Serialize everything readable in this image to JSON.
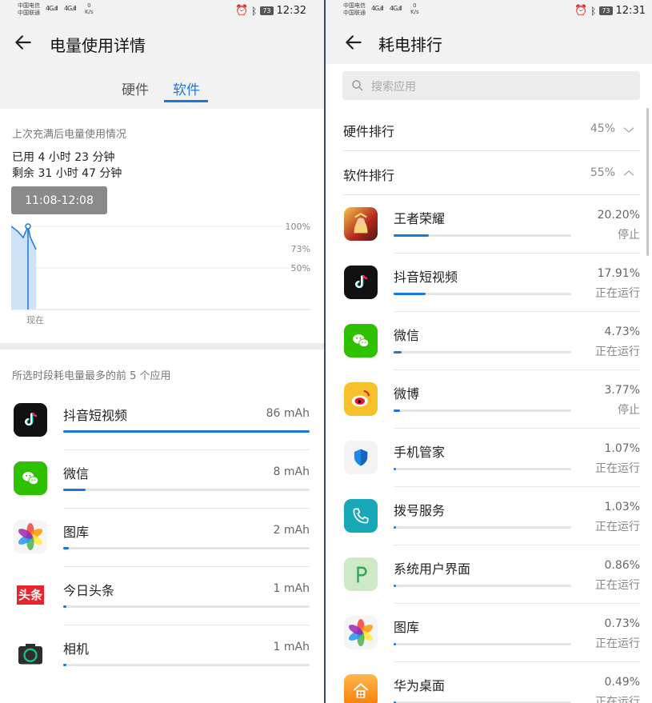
{
  "left": {
    "status": {
      "carrier1": "中国电信",
      "carrier2": "中国联通",
      "net1": "4G",
      "net2": "4G",
      "speed_value": "0",
      "speed_unit": "K/s",
      "battery": "73",
      "time": "12:32"
    },
    "title": "电量使用详情",
    "tabs": [
      "硬件",
      "软件"
    ],
    "active_tab": "软件",
    "since_charge": "上次充满后电量使用情况",
    "used": "已用 4 小时 23 分钟",
    "remaining": "剩余 31 小时 47 分钟",
    "time_range": "11:08-12:08",
    "chart_labels": {
      "p100": "100%",
      "p73": "73%",
      "p50": "50%",
      "now": "现在"
    },
    "top_apps_title": "所选时段耗电量最多的前 5 个应用",
    "apps": [
      {
        "name": "抖音短视频",
        "value": "86 mAh",
        "fill": 1.0,
        "icon": "douyin-icon"
      },
      {
        "name": "微信",
        "value": "8 mAh",
        "fill": 0.09,
        "icon": "wechat-icon"
      },
      {
        "name": "图库",
        "value": "2 mAh",
        "fill": 0.023,
        "icon": "gallery-icon"
      },
      {
        "name": "今日头条",
        "value": "1 mAh",
        "fill": 0.012,
        "icon": "toutiao-icon"
      },
      {
        "name": "相机",
        "value": "1 mAh",
        "fill": 0.012,
        "icon": "camera-icon"
      }
    ],
    "toutiao_logo": "头条"
  },
  "right": {
    "status": {
      "carrier1": "中国电信",
      "carrier2": "中国联通",
      "net1": "4G",
      "net2": "4G",
      "speed_value": "0",
      "speed_unit": "K/s",
      "battery": "73",
      "time": "12:31"
    },
    "title": "耗电排行",
    "search_placeholder": "搜索应用",
    "hardware": {
      "label": "硬件排行",
      "pct": "45%"
    },
    "software": {
      "label": "软件排行",
      "pct": "55%"
    },
    "apps": [
      {
        "name": "王者荣耀",
        "pct": "20.20%",
        "status": "停止",
        "fill": 0.2,
        "icon": "honor-of-kings-icon"
      },
      {
        "name": "抖音短视频",
        "pct": "17.91%",
        "status": "正在运行",
        "fill": 0.18,
        "icon": "douyin-icon"
      },
      {
        "name": "微信",
        "pct": "4.73%",
        "status": "正在运行",
        "fill": 0.047,
        "icon": "wechat-icon"
      },
      {
        "name": "微博",
        "pct": "3.77%",
        "status": "停止",
        "fill": 0.038,
        "icon": "weibo-icon"
      },
      {
        "name": "手机管家",
        "pct": "1.07%",
        "status": "正在运行",
        "fill": 0.011,
        "icon": "phone-manager-icon"
      },
      {
        "name": "拨号服务",
        "pct": "1.03%",
        "status": "正在运行",
        "fill": 0.01,
        "icon": "dialer-icon"
      },
      {
        "name": "系统用户界面",
        "pct": "0.86%",
        "status": "正在运行",
        "fill": 0.009,
        "icon": "system-ui-icon"
      },
      {
        "name": "图库",
        "pct": "0.73%",
        "status": "正在运行",
        "fill": 0.007,
        "icon": "gallery-icon"
      },
      {
        "name": "华为桌面",
        "pct": "0.49%",
        "status": "正在运行",
        "fill": 0.005,
        "icon": "huawei-home-icon"
      }
    ]
  },
  "colors": {
    "accent": "#1c77d8",
    "chart_fill": "#cfe3f8"
  }
}
